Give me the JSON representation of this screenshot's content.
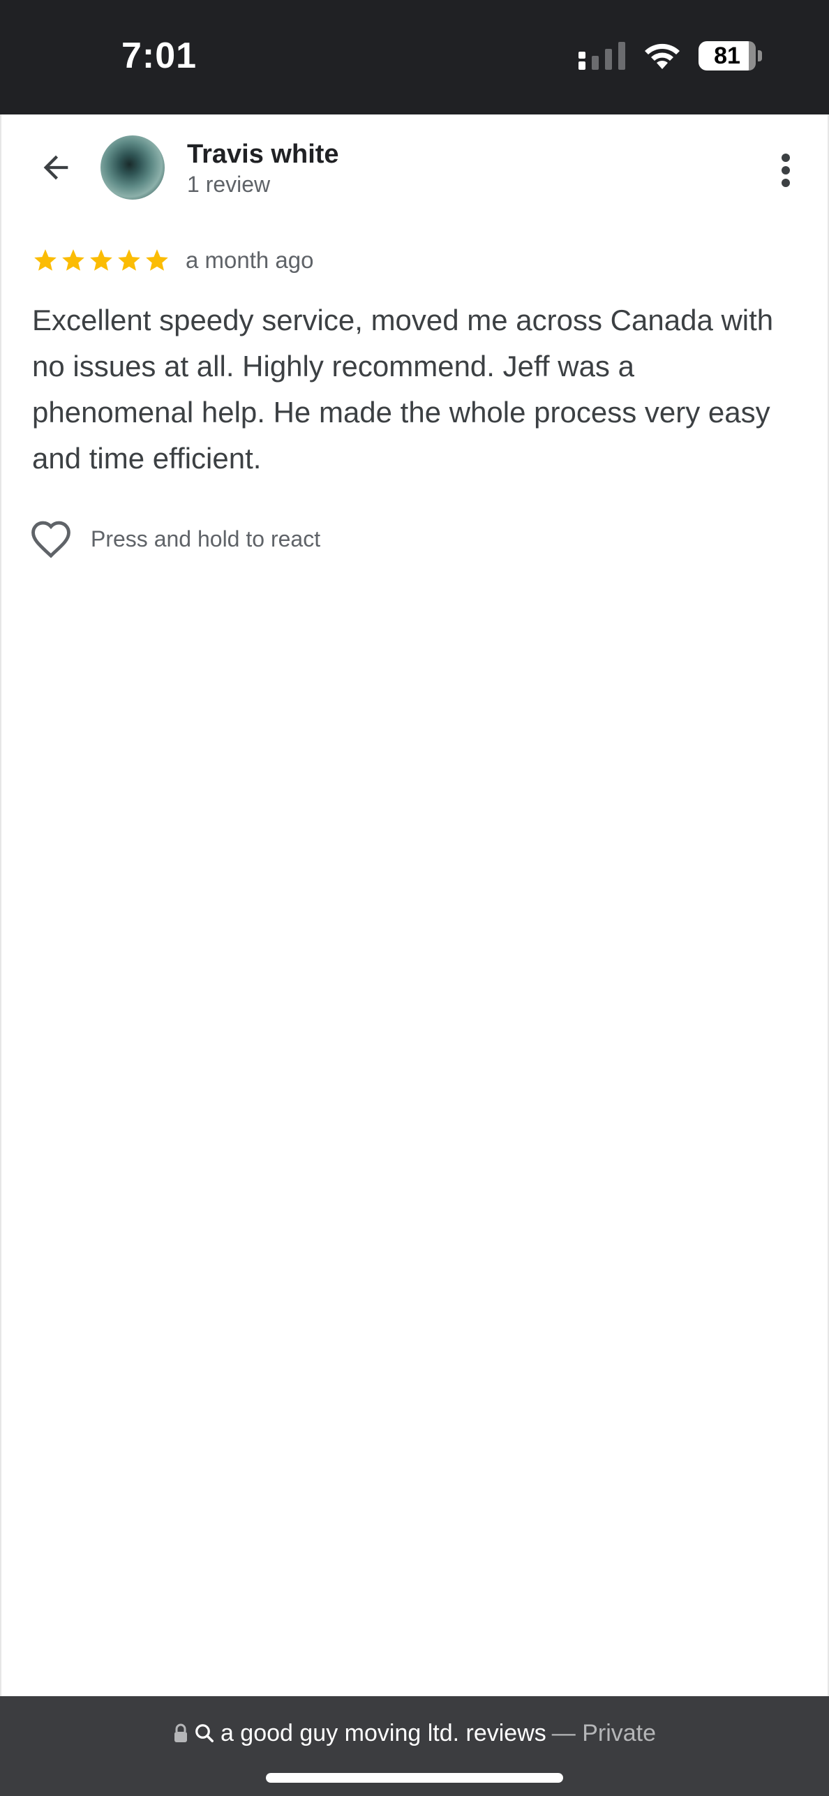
{
  "status_bar": {
    "time": "7:01",
    "battery": "81",
    "icons": [
      "cellular-signal-icon",
      "wifi-icon",
      "battery-icon"
    ]
  },
  "reviewer": {
    "name": "Travis white",
    "review_count": "1 review"
  },
  "review": {
    "rating": 5,
    "max_rating": 5,
    "time": "a month ago",
    "text": "Excellent speedy service, moved me across Canada with no issues at all. Highly recommend. Jeff was a phenomenal help. He made the whole process very easy and time efficient."
  },
  "react": {
    "label": "Press and hold to react"
  },
  "url_bar": {
    "query": "a good guy moving ltd. reviews",
    "mode": "— Private"
  },
  "colors": {
    "status_bar_bg": "#202124",
    "star": "#FBBC04",
    "text_primary": "#202124",
    "text_secondary": "#5f6368",
    "bottom_bar_bg": "#3c3d40"
  }
}
